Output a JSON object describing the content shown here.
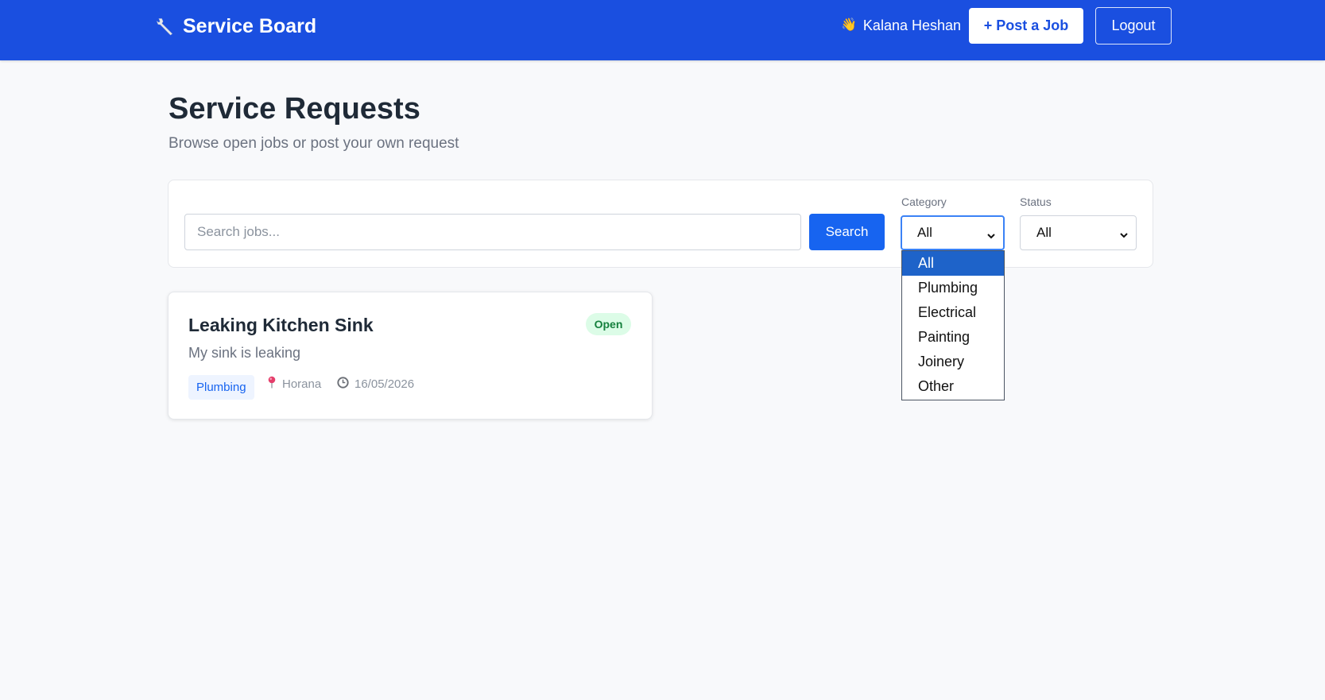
{
  "header": {
    "brand": "Service Board",
    "brand_icon": "wrench-icon",
    "greeting_icon": "waving-hand-icon",
    "user_name": "Kalana Heshan",
    "post_job_label": "+ Post a Job",
    "logout_label": "Logout",
    "accent_color": "#1a4fe0"
  },
  "page": {
    "title": "Service Requests",
    "subtitle": "Browse open jobs or post your own request"
  },
  "filters": {
    "search_placeholder": "Search jobs...",
    "search_value": "",
    "search_button": "Search",
    "category": {
      "label": "Category",
      "selected": "All",
      "options": [
        "All",
        "Plumbing",
        "Electrical",
        "Painting",
        "Joinery",
        "Other"
      ],
      "dropdown_open": true
    },
    "status": {
      "label": "Status",
      "selected": "All"
    }
  },
  "jobs": [
    {
      "title": "Leaking Kitchen Sink",
      "status": "Open",
      "description": "My sink is leaking",
      "category": "Plumbing",
      "location_icon": "pin-icon",
      "location": "Horana",
      "date_icon": "clock-icon",
      "date": "16/05/2026"
    }
  ]
}
